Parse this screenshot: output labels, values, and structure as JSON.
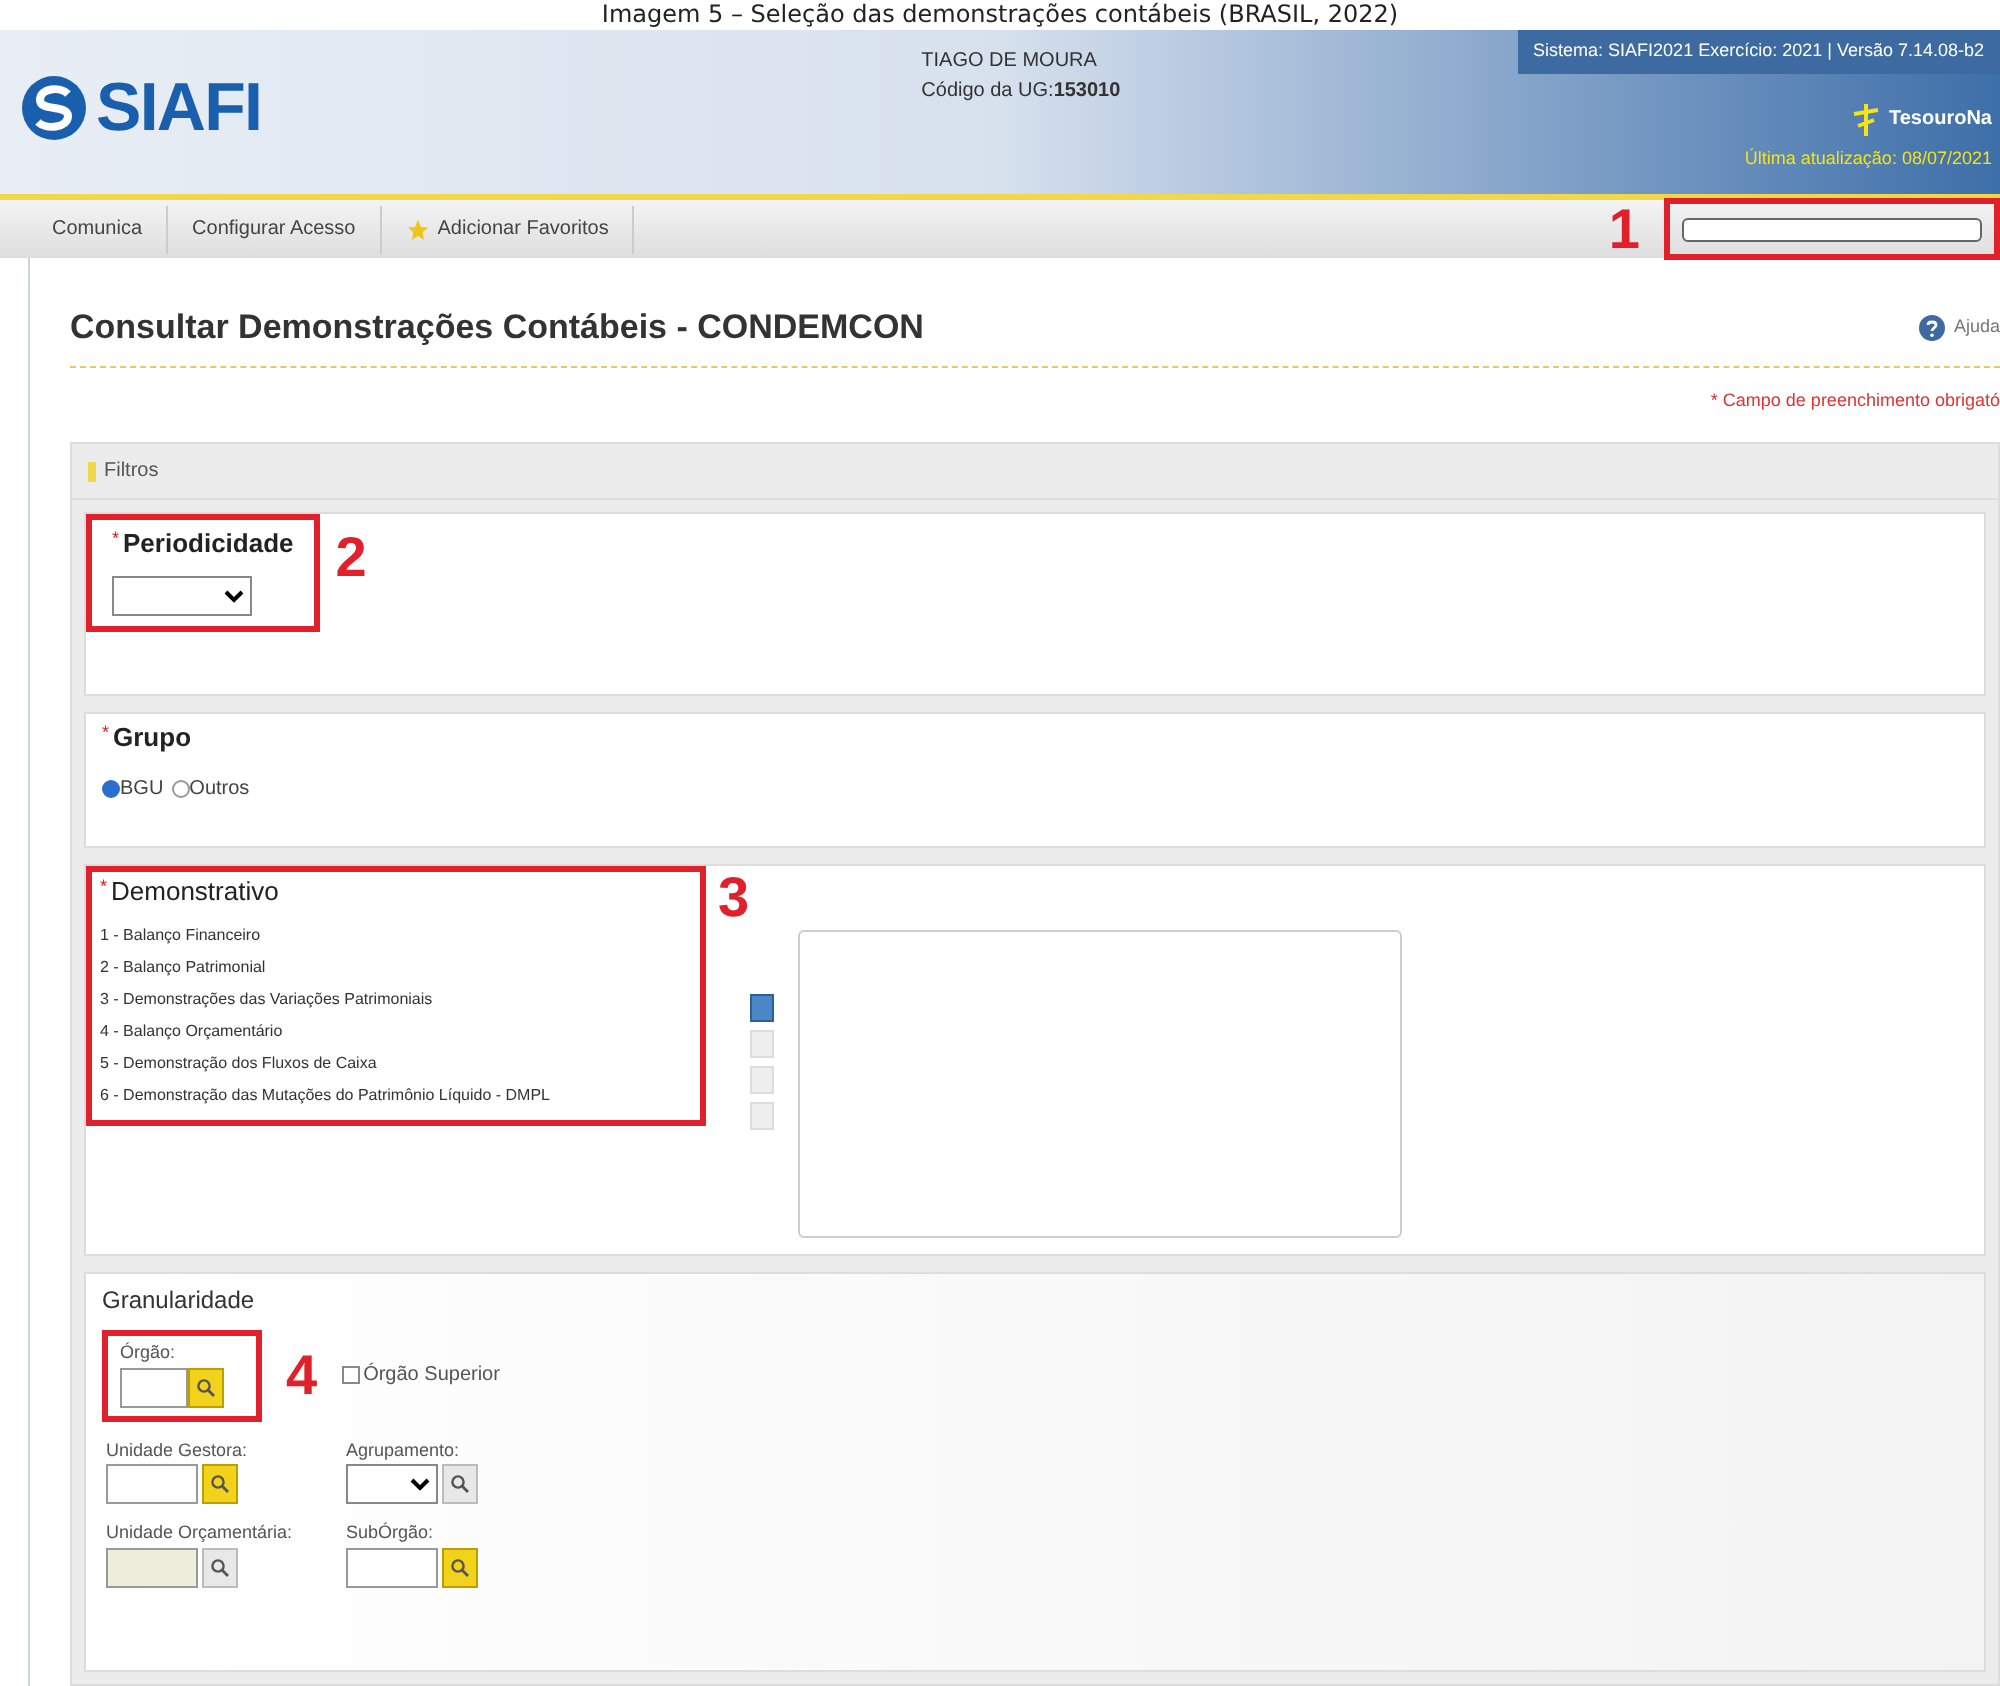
{
  "caption": "Imagem 5 – Seleção das demonstrações contábeis (BRASIL, 2022)",
  "header": {
    "logo": "SIAFI",
    "user": "TIAGO DE MOURA",
    "ug_label": "Código da UG:",
    "ug_value": "153010",
    "system_info": "Sistema: SIAFI2021 Exercício: 2021 | Versão 7.14.08-b2",
    "brand": "TesouroNa",
    "last_update": "Última atualização: 08/07/2021"
  },
  "nav": {
    "items": [
      {
        "label": "Comunica",
        "icon": false
      },
      {
        "label": "Configurar Acesso",
        "icon": false
      },
      {
        "label": "Adicionar Favoritos",
        "icon": true
      }
    ],
    "search_annotation": "1"
  },
  "page": {
    "title": "Consultar Demonstrações Contábeis - CONDEMCON",
    "help": "Ajuda",
    "required_note": "* Campo de preenchimento obrigató"
  },
  "filters": {
    "title": "Filtros",
    "periodicidade": {
      "required_mark": "*",
      "legend": "Periodicidade",
      "annotation": "2"
    },
    "grupo": {
      "required_mark": "*",
      "legend": "Grupo",
      "options": [
        {
          "label": "BGU",
          "selected": true
        },
        {
          "label": "Outros",
          "selected": false
        }
      ]
    },
    "demonstrativo": {
      "required_mark": "*",
      "legend": "Demonstrativo",
      "annotation": "3",
      "items": [
        {
          "label": "1 - Balanço Financeiro"
        },
        {
          "label": "2 - Balanço Patrimonial"
        },
        {
          "label": "3 - Demonstrações das Variações Patrimoniais"
        },
        {
          "label": "4 - Balanço Orçamentário"
        },
        {
          "label": "5 - Demonstração dos Fluxos de Caixa"
        },
        {
          "label": "6 - Demonstração das Mutações do Patrimônio Líquido - DMPL"
        }
      ],
      "transfer_buttons": [
        {
          "disabled": false
        },
        {
          "disabled": true
        },
        {
          "disabled": true
        },
        {
          "disabled": true
        }
      ]
    },
    "granularidade": {
      "legend": "Granularidade",
      "orgao": {
        "label": "Órgão:",
        "annotation": "4"
      },
      "orgao_superior": {
        "label": "Órgão Superior",
        "checked": false
      },
      "fields": [
        {
          "label": "Unidade Gestora:",
          "kind": "lookup",
          "disabled": false
        },
        {
          "label": "Agrupamento:",
          "kind": "select",
          "disabled": false
        },
        {
          "label": "Unidade Orçamentária:",
          "kind": "lookup",
          "disabled": true
        },
        {
          "label": "SubÓrgão:",
          "kind": "lookup",
          "disabled": false
        }
      ]
    }
  }
}
